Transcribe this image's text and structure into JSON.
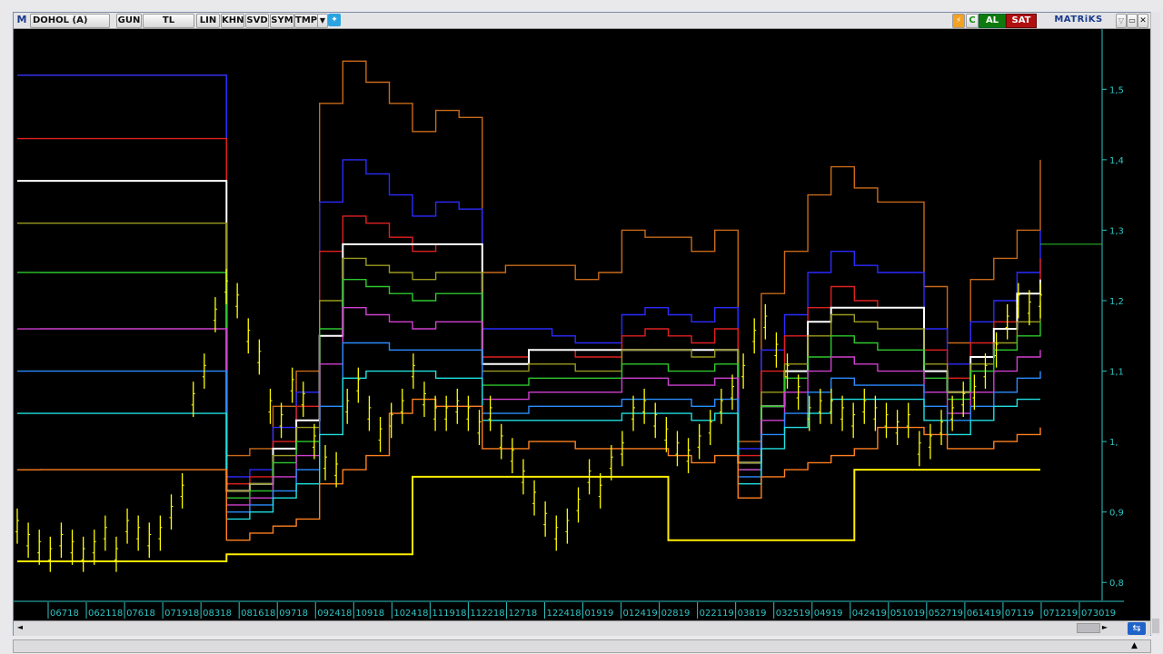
{
  "toolbar": {
    "logo": "M",
    "symbol": "DOHOL (A)",
    "buttons": [
      "GUN",
      "TL",
      "LIN",
      "KHN",
      "SVD",
      "SYM",
      "TMP"
    ],
    "buy_label": "AL",
    "sell_label": "SAT",
    "brand": "MATRiKS"
  },
  "colors": {
    "background": "#000000",
    "axis": "#2fc4c4",
    "price": "#ffff00",
    "buy": "#0e7a0e",
    "sell": "#b01010"
  },
  "chart_data": {
    "type": "line",
    "yticks": [
      "1,5",
      "1,4",
      "1,3",
      "1,2",
      "1,1",
      "1,",
      "0,9",
      "0,8"
    ],
    "ytick_values": [
      1.5,
      1.4,
      1.3,
      1.2,
      1.1,
      1.0,
      0.9,
      0.8
    ],
    "ylim": [
      0.79,
      1.57
    ],
    "x_labels": [
      "06718",
      "062118",
      "07618",
      "071918",
      "08318",
      "081618",
      "09718",
      "092418",
      "10918",
      "102418",
      "111918",
      "112218",
      "12718",
      "122418",
      "01919",
      "012419",
      "02819",
      "022119",
      "03819",
      "032519",
      "04919",
      "042419",
      "051019",
      "052719",
      "061419",
      "07119",
      "071219",
      "073019"
    ],
    "last_price_marker": 1.28,
    "series": [
      {
        "color": "#c86a1a",
        "values": [
          1.52,
          1.52,
          1.52,
          1.52,
          1.52,
          1.52,
          1.52,
          1.52,
          1.52,
          0.98,
          0.99,
          1.05,
          1.1,
          1.48,
          1.54,
          1.51,
          1.48,
          1.44,
          1.47,
          1.46,
          1.24,
          1.25,
          1.25,
          1.25,
          1.23,
          1.24,
          1.3,
          1.29,
          1.29,
          1.27,
          1.3,
          1.0,
          1.21,
          1.27,
          1.35,
          1.39,
          1.36,
          1.34,
          1.34,
          1.22,
          1.14,
          1.23,
          1.26,
          1.3,
          1.4
        ]
      },
      {
        "color": "#2b2bff",
        "values": [
          1.52,
          1.52,
          1.52,
          1.52,
          1.52,
          1.52,
          1.52,
          1.52,
          1.52,
          0.95,
          0.96,
          1.02,
          1.07,
          1.34,
          1.4,
          1.38,
          1.35,
          1.32,
          1.34,
          1.33,
          1.16,
          1.16,
          1.16,
          1.15,
          1.14,
          1.14,
          1.18,
          1.19,
          1.18,
          1.17,
          1.19,
          0.99,
          1.13,
          1.18,
          1.24,
          1.27,
          1.25,
          1.24,
          1.24,
          1.16,
          1.11,
          1.17,
          1.2,
          1.24,
          1.3
        ]
      },
      {
        "color": "#e02020",
        "values": [
          1.43,
          1.43,
          1.43,
          1.43,
          1.43,
          1.43,
          1.43,
          1.43,
          1.43,
          0.94,
          0.95,
          1.0,
          1.05,
          1.27,
          1.32,
          1.31,
          1.29,
          1.27,
          1.28,
          1.28,
          1.12,
          1.12,
          1.13,
          1.13,
          1.12,
          1.12,
          1.15,
          1.16,
          1.15,
          1.14,
          1.16,
          0.98,
          1.1,
          1.15,
          1.19,
          1.22,
          1.2,
          1.19,
          1.19,
          1.13,
          1.09,
          1.14,
          1.17,
          1.21,
          1.26
        ]
      },
      {
        "color": "#ffffff",
        "values": [
          1.37,
          1.37,
          1.37,
          1.37,
          1.37,
          1.37,
          1.37,
          1.37,
          1.37,
          0.93,
          0.94,
          0.99,
          1.03,
          1.15,
          1.28,
          1.28,
          1.28,
          1.28,
          1.28,
          1.28,
          1.11,
          1.11,
          1.13,
          1.13,
          1.13,
          1.13,
          1.13,
          1.13,
          1.13,
          1.13,
          1.13,
          0.97,
          1.05,
          1.1,
          1.17,
          1.19,
          1.19,
          1.19,
          1.19,
          1.1,
          1.07,
          1.12,
          1.16,
          1.21,
          1.23
        ]
      },
      {
        "color": "#9a9a20",
        "values": [
          1.31,
          1.31,
          1.31,
          1.31,
          1.31,
          1.31,
          1.31,
          1.31,
          1.31,
          0.93,
          0.94,
          0.98,
          1.02,
          1.2,
          1.26,
          1.25,
          1.24,
          1.23,
          1.24,
          1.24,
          1.1,
          1.1,
          1.11,
          1.11,
          1.1,
          1.1,
          1.13,
          1.13,
          1.13,
          1.12,
          1.13,
          0.97,
          1.07,
          1.11,
          1.15,
          1.18,
          1.17,
          1.16,
          1.16,
          1.11,
          1.07,
          1.11,
          1.14,
          1.17,
          1.2
        ]
      },
      {
        "color": "#2ec82e",
        "values": [
          1.24,
          1.24,
          1.24,
          1.24,
          1.24,
          1.24,
          1.24,
          1.24,
          1.24,
          0.92,
          0.93,
          0.97,
          1.0,
          1.16,
          1.23,
          1.22,
          1.21,
          1.2,
          1.21,
          1.21,
          1.08,
          1.08,
          1.09,
          1.09,
          1.09,
          1.09,
          1.11,
          1.11,
          1.1,
          1.1,
          1.11,
          0.96,
          1.05,
          1.09,
          1.12,
          1.15,
          1.14,
          1.13,
          1.13,
          1.09,
          1.06,
          1.1,
          1.13,
          1.15,
          1.17
        ]
      },
      {
        "color": "#d040d0",
        "values": [
          1.16,
          1.16,
          1.16,
          1.16,
          1.16,
          1.16,
          1.16,
          1.16,
          1.16,
          0.91,
          0.92,
          0.95,
          0.98,
          1.11,
          1.19,
          1.18,
          1.17,
          1.16,
          1.17,
          1.17,
          1.06,
          1.06,
          1.07,
          1.07,
          1.07,
          1.07,
          1.09,
          1.09,
          1.08,
          1.08,
          1.09,
          0.96,
          1.03,
          1.07,
          1.1,
          1.12,
          1.11,
          1.1,
          1.1,
          1.07,
          1.04,
          1.07,
          1.1,
          1.12,
          1.13
        ]
      },
      {
        "color": "#2a8cff",
        "values": [
          1.1,
          1.1,
          1.1,
          1.1,
          1.1,
          1.1,
          1.1,
          1.1,
          1.1,
          0.9,
          0.91,
          0.93,
          0.96,
          1.05,
          1.14,
          1.14,
          1.13,
          1.13,
          1.13,
          1.13,
          1.04,
          1.04,
          1.05,
          1.05,
          1.05,
          1.05,
          1.06,
          1.06,
          1.06,
          1.05,
          1.06,
          0.95,
          1.01,
          1.04,
          1.07,
          1.09,
          1.08,
          1.08,
          1.08,
          1.05,
          1.03,
          1.05,
          1.07,
          1.09,
          1.1
        ]
      },
      {
        "color": "#20e0e0",
        "values": [
          1.04,
          1.04,
          1.04,
          1.04,
          1.04,
          1.04,
          1.04,
          1.04,
          1.04,
          0.89,
          0.9,
          0.92,
          0.94,
          1.01,
          1.09,
          1.1,
          1.1,
          1.1,
          1.09,
          1.09,
          1.03,
          1.03,
          1.03,
          1.03,
          1.03,
          1.03,
          1.04,
          1.04,
          1.04,
          1.03,
          1.04,
          0.94,
          0.99,
          1.02,
          1.04,
          1.06,
          1.06,
          1.06,
          1.06,
          1.03,
          1.01,
          1.03,
          1.05,
          1.06,
          1.06
        ]
      },
      {
        "color": "#ff8020",
        "values": [
          0.96,
          0.96,
          0.96,
          0.96,
          0.96,
          0.96,
          0.96,
          0.96,
          0.96,
          0.86,
          0.87,
          0.88,
          0.89,
          0.94,
          0.96,
          0.98,
          1.04,
          1.06,
          1.05,
          1.05,
          0.99,
          0.99,
          1.0,
          1.0,
          0.99,
          0.99,
          0.99,
          0.99,
          0.98,
          0.97,
          0.98,
          0.92,
          0.95,
          0.96,
          0.97,
          0.98,
          0.99,
          1.02,
          1.02,
          1.01,
          0.99,
          0.99,
          1.0,
          1.01,
          1.02
        ]
      },
      {
        "color": "#ffee00",
        "values": [
          0.83,
          0.83,
          0.83,
          0.83,
          0.83,
          0.83,
          0.83,
          0.83,
          0.83,
          0.84,
          0.84,
          0.84,
          0.84,
          0.84,
          0.84,
          0.84,
          0.84,
          0.95,
          0.95,
          0.95,
          0.95,
          0.95,
          0.95,
          0.95,
          0.95,
          0.95,
          0.95,
          0.95,
          0.86,
          0.86,
          0.86,
          0.86,
          0.86,
          0.86,
          0.86,
          0.86,
          0.96,
          0.96,
          0.96,
          0.96,
          0.96,
          0.96,
          0.96,
          0.96,
          0.96
        ]
      }
    ],
    "price": [
      0.88,
      0.86,
      0.85,
      0.84,
      0.86,
      0.85,
      0.84,
      0.85,
      0.87,
      0.84,
      0.88,
      0.87,
      0.86,
      0.87,
      0.9,
      0.93,
      1.06,
      1.1,
      1.18,
      1.22,
      1.2,
      1.15,
      1.12,
      1.05,
      1.03,
      1.08,
      1.06,
      1.0,
      0.97,
      0.96,
      1.05,
      1.08,
      1.04,
      1.01,
      1.03,
      1.05,
      1.1,
      1.06,
      1.04,
      1.04,
      1.05,
      1.04,
      1.02,
      1.04,
      1.0,
      0.98,
      0.95,
      0.92,
      0.89,
      0.87,
      0.88,
      0.91,
      0.95,
      0.93,
      0.97,
      0.99,
      1.04,
      1.05,
      1.03,
      1.01,
      0.99,
      0.98,
      1.0,
      1.02,
      1.05,
      1.07,
      1.1,
      1.15,
      1.17,
      1.13,
      1.1,
      1.07,
      1.04,
      1.05,
      1.05,
      1.04,
      1.03,
      1.05,
      1.04,
      1.03,
      1.02,
      1.03,
      0.99,
      1.0,
      1.02,
      1.04,
      1.06,
      1.07,
      1.1,
      1.13,
      1.17,
      1.2,
      1.19,
      1.2
    ]
  }
}
